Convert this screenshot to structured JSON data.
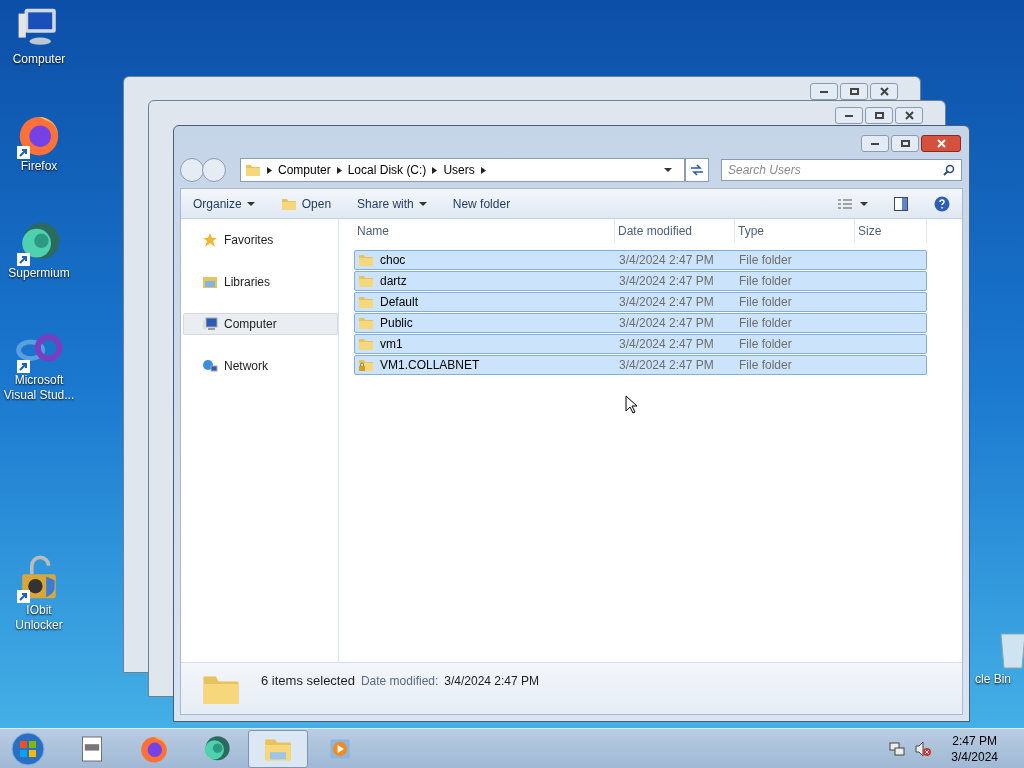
{
  "desktop_icons": [
    {
      "label": "Computer",
      "kind": "computer",
      "shortcut": false
    },
    {
      "label": "Firefox",
      "kind": "firefox",
      "shortcut": true
    },
    {
      "label": "Supermium",
      "kind": "supermium",
      "shortcut": true
    },
    {
      "label": "Microsoft Visual Stud...",
      "kind": "vs",
      "shortcut": true
    },
    {
      "label": "IObit Unlocker",
      "kind": "unlocker",
      "shortcut": true
    }
  ],
  "recycle_bin": {
    "label": "cle Bin"
  },
  "window": {
    "breadcrumb": [
      "Computer",
      "Local Disk (C:)",
      "Users"
    ],
    "search": {
      "placeholder": "Search Users"
    },
    "toolbar": [
      {
        "label": "Organize",
        "kind": "menu"
      },
      {
        "label": "Open",
        "kind": "open"
      },
      {
        "label": "Share with",
        "kind": "menu"
      },
      {
        "label": "New folder",
        "kind": "plain"
      }
    ],
    "nav": [
      {
        "label": "Favorites",
        "kind": "star",
        "selected": false
      },
      {
        "label": "Libraries",
        "kind": "library",
        "selected": false
      },
      {
        "label": "Computer",
        "kind": "computer",
        "selected": true
      },
      {
        "label": "Network",
        "kind": "network",
        "selected": false
      }
    ],
    "columns": [
      "Name",
      "Date modified",
      "Type",
      "Size"
    ],
    "rows": [
      {
        "name": "choc",
        "date": "3/4/2024 2:47 PM",
        "type": "File folder",
        "selected": true,
        "locked": false
      },
      {
        "name": "dartz",
        "date": "3/4/2024 2:47 PM",
        "type": "File folder",
        "selected": true,
        "locked": false
      },
      {
        "name": "Default",
        "date": "3/4/2024 2:47 PM",
        "type": "File folder",
        "selected": true,
        "locked": false
      },
      {
        "name": "Public",
        "date": "3/4/2024 2:47 PM",
        "type": "File folder",
        "selected": true,
        "locked": false
      },
      {
        "name": "vm1",
        "date": "3/4/2024 2:47 PM",
        "type": "File folder",
        "selected": true,
        "locked": false
      },
      {
        "name": "VM1.COLLABNET",
        "date": "3/4/2024 2:47 PM",
        "type": "File folder",
        "selected": true,
        "locked": true
      }
    ],
    "details": {
      "summary": "6 items selected",
      "label": "Date modified:",
      "value": "3/4/2024 2:47 PM"
    }
  },
  "taskbar": {
    "apps": [
      {
        "kind": "notepad",
        "selected": false
      },
      {
        "kind": "firefox",
        "selected": false
      },
      {
        "kind": "supermium",
        "selected": false
      },
      {
        "kind": "explorer",
        "selected": true
      },
      {
        "kind": "media",
        "selected": false
      }
    ],
    "time": "2:47 PM",
    "date": "3/4/2024"
  }
}
